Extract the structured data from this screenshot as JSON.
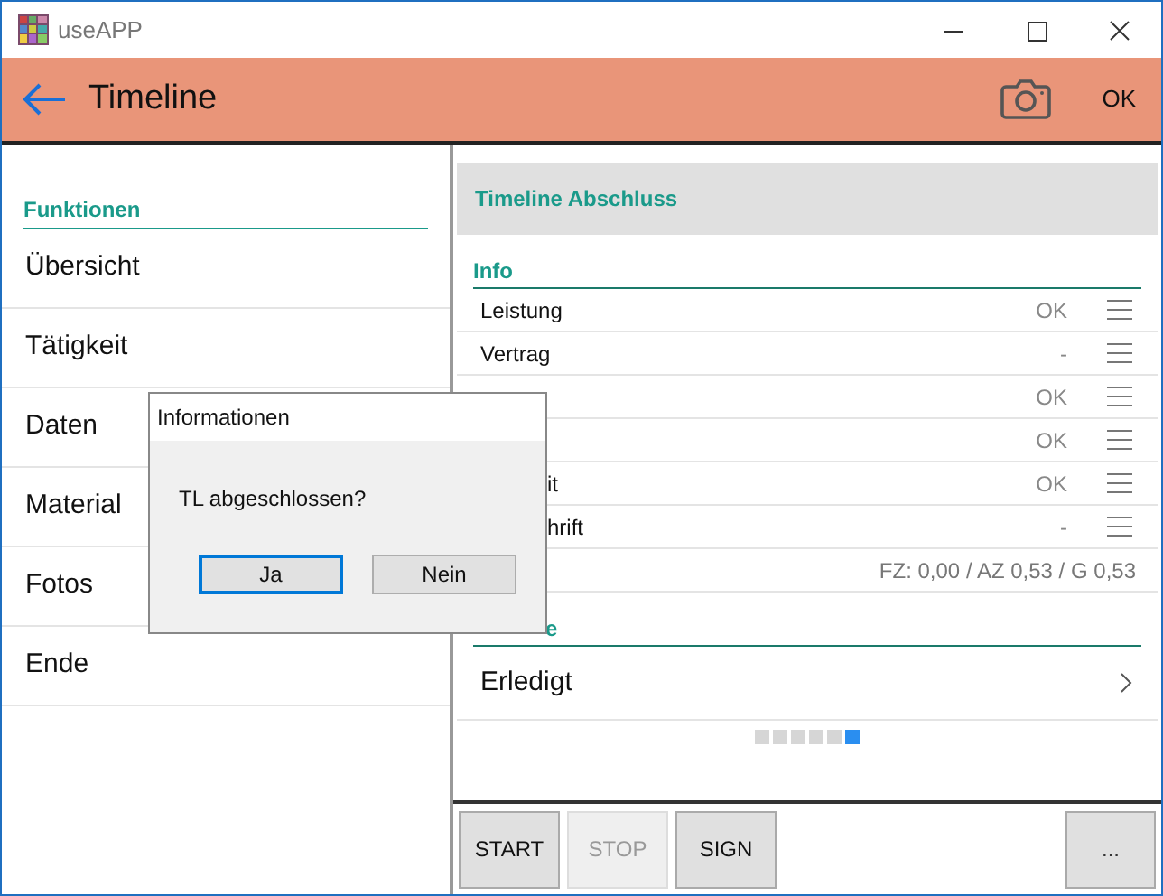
{
  "window": {
    "title": "useAPP"
  },
  "header": {
    "title": "Timeline",
    "action": "OK"
  },
  "sidebar": {
    "heading": "Funktionen",
    "items": [
      {
        "label": "Übersicht"
      },
      {
        "label": "Tätigkeit"
      },
      {
        "label": "Daten"
      },
      {
        "label": "Material"
      },
      {
        "label": "Fotos"
      },
      {
        "label": "Ende"
      }
    ]
  },
  "panel": {
    "title": "Timeline Abschluss",
    "section": "Info",
    "rows": [
      {
        "kind": "status",
        "label": "Leistung",
        "value": "OK"
      },
      {
        "kind": "status",
        "label": "Vertrag",
        "value": "-"
      },
      {
        "kind": "status",
        "value": "OK"
      },
      {
        "kind": "status",
        "value": "OK"
      },
      {
        "kind": "status",
        "label": "it",
        "value": "OK"
      },
      {
        "kind": "status",
        "label": "hrift",
        "value": "-"
      },
      {
        "kind": "summary",
        "value": "FZ: 0,00 / AZ 0,53 / G 0,53"
      }
    ],
    "section_2": "e",
    "nav_item": "Erledigt",
    "pages": [
      {
        "selected": false
      },
      {
        "selected": false
      },
      {
        "selected": false
      },
      {
        "selected": false
      },
      {
        "selected": false
      },
      {
        "selected": true
      }
    ]
  },
  "toolbar": [
    {
      "label": "START",
      "disabled": false
    },
    {
      "label": "STOP",
      "disabled": true
    },
    {
      "label": "SIGN",
      "disabled": false
    }
  ],
  "more_button": "...",
  "dialog": {
    "title": "Informationen",
    "message": "TL abgeschlossen?",
    "buttons": [
      {
        "label": "Ja",
        "selected": true
      },
      {
        "label": "Nein",
        "selected": false
      }
    ]
  }
}
